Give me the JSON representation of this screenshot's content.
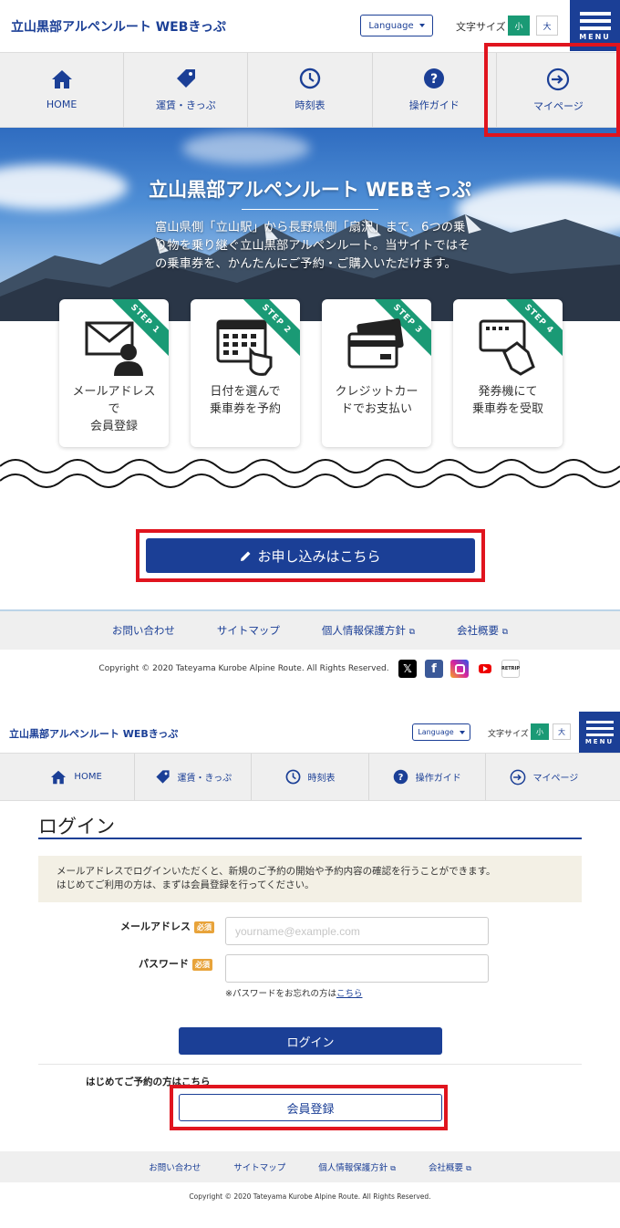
{
  "top": {
    "site_title": "立山黒部アルペンルート WEBきっぷ",
    "language_label": "Language",
    "font_size_label": "文字サイズ",
    "font_small": "小",
    "font_large": "大",
    "menu_label": "MENU",
    "nav": [
      "HOME",
      "運賃・きっぷ",
      "時刻表",
      "操作ガイド",
      "マイページ"
    ],
    "hero_title": "立山黒部アルペンルート WEBきっぷ",
    "hero_text": "富山県側「立山駅」から長野県側「扇沢」まで、6つの乗り物を乗り継ぐ立山黒部アルペンルート。当サイトではその乗車券を、かんたんにご予約・ご購入いただけます。",
    "steps": [
      {
        "badge": "STEP 1",
        "text_lines": [
          "メールアドレス",
          "で",
          "会員登録"
        ]
      },
      {
        "badge": "STEP 2",
        "text_lines": [
          "日付を選んで",
          "乗車券を予約"
        ]
      },
      {
        "badge": "STEP 3",
        "text_lines": [
          "クレジットカー",
          "ドでお支払い"
        ]
      },
      {
        "badge": "STEP 4",
        "text_lines": [
          "発券機にて",
          "乗車券を受取"
        ]
      }
    ],
    "apply_button": "お申し込みはこちら",
    "footer_links": [
      "お問い合わせ",
      "サイトマップ",
      "個人情報保護方針",
      "会社概要"
    ],
    "copyright": "Copyright © 2020 Tateyama Kurobe Alpine Route. All Rights Reserved.",
    "social_retrip": "RETRIP"
  },
  "bottom": {
    "site_title": "立山黒部アルペンルート WEBきっぷ",
    "language_label": "Language",
    "font_size_label": "文字サイズ",
    "font_small": "小",
    "font_large": "大",
    "menu_label": "MENU",
    "nav": [
      "HOME",
      "運賃・きっぷ",
      "時刻表",
      "操作ガイド",
      "マイページ"
    ],
    "login_title": "ログイン",
    "notice_line1": "メールアドレスでログインいただくと、新規のご予約の開始や予約内容の確認を行うことができます。",
    "notice_line2": "はじめてご利用の方は、まずは会員登録を行ってください。",
    "email_label": "メールアドレス",
    "password_label": "パスワード",
    "required_badge": "必須",
    "email_placeholder": "yourname@example.com",
    "forgot_prefix": "※パスワードをお忘れの方は",
    "forgot_link": "こちら",
    "login_button": "ログイン",
    "first_time_label": "はじめてご予約の方はこちら",
    "register_button": "会員登録",
    "footer_links": [
      "お問い合わせ",
      "サイトマップ",
      "個人情報保護方針",
      "会社概要"
    ],
    "copyright": "Copyright © 2020 Tateyama Kurobe Alpine Route. All Rights Reserved."
  },
  "colors": {
    "brand_blue": "#1b3f96",
    "accent_green": "#1a9a75",
    "highlight_red": "#e0141e"
  }
}
